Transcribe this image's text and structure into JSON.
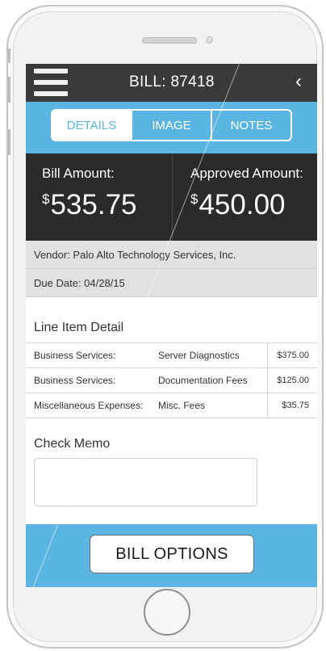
{
  "header": {
    "title": "BILL: 87418",
    "back_icon": "chevron-left-icon",
    "menu_icon": "hamburger-menu-icon"
  },
  "tabs": [
    {
      "label": "DETAILS",
      "active": true
    },
    {
      "label": "IMAGE",
      "active": false
    },
    {
      "label": "NOTES",
      "active": false
    }
  ],
  "amounts": {
    "bill_label": "Bill Amount:",
    "bill_currency": "$",
    "bill_value": "535.75",
    "approved_label": "Approved Amount:",
    "approved_currency": "$",
    "approved_value": "450.00"
  },
  "info": {
    "vendor": "Vendor:  Palo Alto Technology Services, Inc.",
    "due_date": "Due Date: 04/28/15"
  },
  "line_items": {
    "title": "Line Item Detail",
    "rows": [
      {
        "category": "Business Services:",
        "description": "Server Diagnostics",
        "amount": "$375.00"
      },
      {
        "category": "Business Services:",
        "description": "Documentation Fees",
        "amount": "$125.00"
      },
      {
        "category": "Miscellaneous Expenses:",
        "description": "Misc. Fees",
        "amount": "$35.75"
      }
    ]
  },
  "memo": {
    "label": "Check Memo",
    "value": ""
  },
  "footer": {
    "button_label": "BILL OPTIONS"
  },
  "colors": {
    "accent_blue": "#5ab5e2",
    "header_dark": "#3a3a3a",
    "amount_panel": "#2a2a2a",
    "info_gray": "#e1e1e1"
  }
}
